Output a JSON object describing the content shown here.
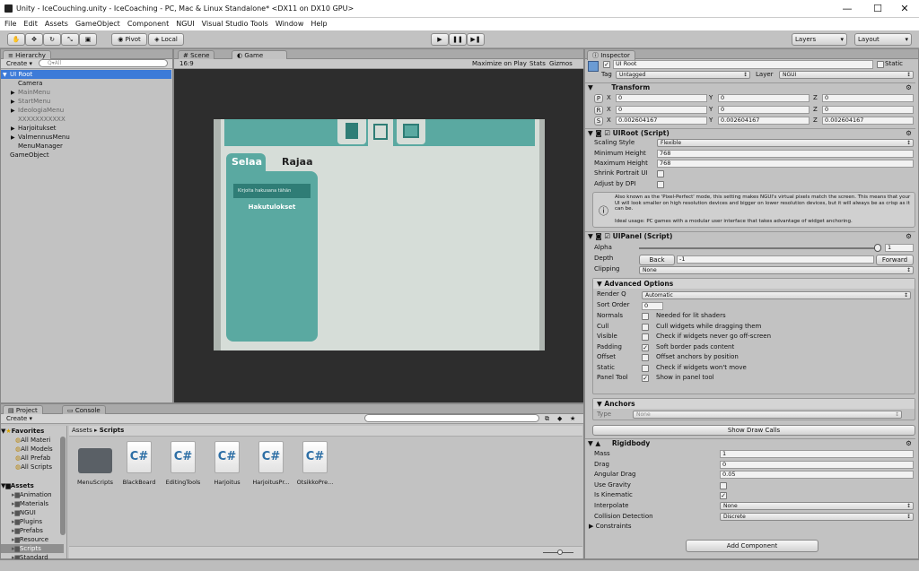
{
  "window": {
    "title": "Unity - IceCouching.unity - IceCoaching - PC, Mac & Linux Standalone* <DX11 on DX10 GPU>",
    "min": "—",
    "max": "☐",
    "close": "✕"
  },
  "menu": [
    "File",
    "Edit",
    "Assets",
    "GameObject",
    "Component",
    "NGUI",
    "Visual Studio Tools",
    "Window",
    "Help"
  ],
  "toolbar": {
    "pivot": "Pivot",
    "local": "Local",
    "layers": "Layers",
    "layout": "Layout",
    "play": "▶",
    "pause": "❚❚",
    "step": "▶❚"
  },
  "hierarchy": {
    "tab": "Hierarchy",
    "create": "Create",
    "search": "Q▾All",
    "items": [
      {
        "label": "UI Root",
        "selected": true,
        "indent": 0,
        "muted": false,
        "arrow": "▼"
      },
      {
        "label": "Camera",
        "indent": 1,
        "muted": false,
        "arrow": ""
      },
      {
        "label": "MainMenu",
        "indent": 1,
        "muted": true,
        "arrow": "▶"
      },
      {
        "label": "StartMenu",
        "indent": 1,
        "muted": true,
        "arrow": "▶"
      },
      {
        "label": "IdeologiaMenu",
        "indent": 1,
        "muted": true,
        "arrow": "▶"
      },
      {
        "label": "XXXXXXXXXXX",
        "indent": 1,
        "muted": true,
        "arrow": ""
      },
      {
        "label": "Harjoitukset",
        "indent": 1,
        "muted": false,
        "arrow": "▶"
      },
      {
        "label": "ValmennusMenu",
        "indent": 1,
        "muted": false,
        "arrow": "▶"
      },
      {
        "label": "MenuManager",
        "indent": 1,
        "muted": false,
        "arrow": ""
      },
      {
        "label": "GameObject",
        "indent": 0,
        "muted": false,
        "arrow": ""
      }
    ]
  },
  "game": {
    "scene_tab": "Scene",
    "game_tab": "Game",
    "aspect": "16:9",
    "maximize": "Maximize on Play",
    "stats": "Stats",
    "gizmos": "Gizmos",
    "tab1": "Selaa",
    "tab2": "Rajaa",
    "search_text": "Kirjoita hakusana tähän",
    "results": "Hakutulokset"
  },
  "project": {
    "tab": "Project",
    "console": "Console",
    "create": "Create",
    "breadcrumb_assets": "Assets",
    "breadcrumb_scripts": "Scripts",
    "favorites": "Favorites",
    "fav_items": [
      "All Materi",
      "All Models",
      "All Prefab",
      "All Scripts"
    ],
    "assets_label": "Assets",
    "asset_items": [
      "Animation",
      "Materials",
      "NGUI",
      "Plugins",
      "Prefabs",
      "Resource",
      "Scripts",
      "Standard"
    ],
    "files": [
      {
        "name": "MenuScripts",
        "type": "folder"
      },
      {
        "name": "BlackBoard",
        "type": "cs"
      },
      {
        "name": "EditingTools",
        "type": "cs"
      },
      {
        "name": "Harjoitus",
        "type": "cs"
      },
      {
        "name": "HarjoitusPr...",
        "type": "cs"
      },
      {
        "name": "OtsikkoPre...",
        "type": "cs"
      }
    ]
  },
  "inspector": {
    "tab": "Inspector",
    "name": "UI Root",
    "static": "Static",
    "tag_label": "Tag",
    "tag": "Untagged",
    "layer_label": "Layer",
    "layer": "NGUI",
    "transform": {
      "title": "Transform",
      "rows": [
        {
          "btn": "P",
          "x": "0",
          "y": "0",
          "z": "0"
        },
        {
          "btn": "R",
          "x": "0",
          "y": "0",
          "z": "0"
        },
        {
          "btn": "S",
          "x": "0.002604167",
          "y": "0.002604167",
          "z": "0.002604167"
        }
      ]
    },
    "uiroot": {
      "title": "UIRoot (Script)",
      "scaling_label": "Scaling Style",
      "scaling": "Flexible",
      "minh_label": "Minimum Height",
      "minh": "768",
      "maxh_label": "Maximum Height",
      "maxh": "768",
      "shrink_label": "Shrink Portrait UI",
      "dpi_label": "Adjust by DPI",
      "info1": "Also known as the 'Pixel-Perfect' mode, this setting makes NGUI's virtual pixels match the screen. This means that your UI will look smaller on high resolution devices and bigger on lower resolution devices, but it will always be as crisp as it can be.",
      "info2": "Ideal usage: PC games with a modular user interface that takes advantage of widget anchoring."
    },
    "uipanel": {
      "title": "UIPanel (Script)",
      "alpha_label": "Alpha",
      "alpha": "1",
      "alpha_level": 1,
      "depth_label": "Depth",
      "back": "Back",
      "depth": "-1",
      "forward": "Forward",
      "clipping_label": "Clipping",
      "clipping": "None",
      "adv_title": "Advanced Options",
      "renderq_label": "Render Q",
      "renderq": "Automatic",
      "sortorder_label": "Sort Order",
      "sortorder": "0",
      "options": [
        {
          "label": "Normals",
          "desc": "Needed for lit shaders",
          "checked": false
        },
        {
          "label": "Cull",
          "desc": "Cull widgets while dragging them",
          "checked": false
        },
        {
          "label": "Visible",
          "desc": "Check if widgets never go off-screen",
          "checked": false
        },
        {
          "label": "Padding",
          "desc": "Soft border pads content",
          "checked": true
        },
        {
          "label": "Offset",
          "desc": "Offset anchors by position",
          "checked": false
        },
        {
          "label": "Static",
          "desc": "Check if widgets won't move",
          "checked": false
        },
        {
          "label": "Panel Tool",
          "desc": "Show in panel tool",
          "checked": true
        }
      ],
      "anchors_title": "Anchors",
      "type_label": "Type",
      "type": "None",
      "show_draw": "Show Draw Calls"
    },
    "rigidbody": {
      "title": "Rigidbody",
      "mass_label": "Mass",
      "mass": "1",
      "drag_label": "Drag",
      "drag": "0",
      "adrag_label": "Angular Drag",
      "adrag": "0.05",
      "gravity_label": "Use Gravity",
      "gravity": false,
      "kinematic_label": "Is Kinematic",
      "kinematic": true,
      "interp_label": "Interpolate",
      "interp": "None",
      "coll_label": "Collision Detection",
      "coll": "Discrete",
      "constraints": "Constraints"
    },
    "add_component": "Add Component"
  },
  "colors": {
    "teal": "#5aa9a1",
    "teal_dark": "#2f7d76",
    "game_bg": "#2d2d2d",
    "selection": "#3d7bd8"
  }
}
